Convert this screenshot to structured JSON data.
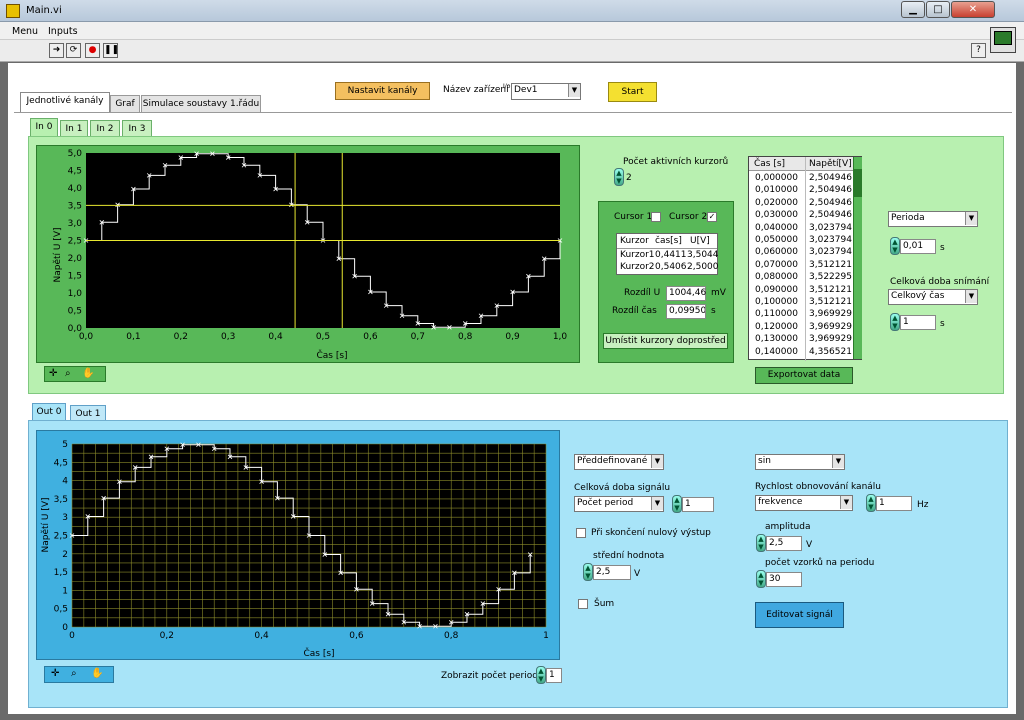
{
  "window": {
    "title": "Main.vi"
  },
  "menu": [
    "Menu",
    "Inputs"
  ],
  "toolbar": {
    "help": "?"
  },
  "top": {
    "set_channels": "Nastavit kanály",
    "device_label": "Název zařízení",
    "device_prefix": "I/o",
    "device_value": "Dev1",
    "start": "Start"
  },
  "main_tabs": [
    "Jednotlivé kanály",
    "Graf",
    "Simulace soustavy 1.řádu"
  ],
  "input_tabs": [
    "In 0",
    "In 1",
    "In 2",
    "In 3"
  ],
  "output_tabs": [
    "Out 0",
    "Out 1"
  ],
  "in_graph": {
    "ylabel": "Napětí U [V]",
    "xlabel": "Čas [s]",
    "yticks": [
      "5,0",
      "4,5",
      "4,0",
      "3,5",
      "3,0",
      "2,5",
      "2,0",
      "1,5",
      "1,0",
      "0,5",
      "0,0"
    ],
    "xticks": [
      "0,0",
      "0,1",
      "0,2",
      "0,3",
      "0,4",
      "0,5",
      "0,6",
      "0,7",
      "0,8",
      "0,9",
      "1,0"
    ]
  },
  "cursors": {
    "count_label": "Počet aktivních kurzorů",
    "count": "2",
    "cursor1_label": "Cursor 1",
    "cursor2_label": "Cursor 2",
    "cursor1_checked": false,
    "cursor2_checked": true,
    "table_headers": [
      "Kurzor",
      "čas[s]",
      "U[V]"
    ],
    "rows": [
      [
        "Kurzor1",
        "0,4411",
        "3,5044"
      ],
      [
        "Kurzor2",
        "0,5406",
        "2,5000"
      ]
    ],
    "diff_u_label": "Rozdíl U",
    "diff_u": "1004,46",
    "diff_u_unit": "mV",
    "diff_t_label": "Rozdíl čas",
    "diff_t": "0,0995025",
    "diff_t_unit": "s",
    "center_button": "Umístit kurzory doprostřed"
  },
  "data_table": {
    "headers": [
      "Čas [s]",
      "Napětí[V]"
    ],
    "rows": [
      [
        "0,000000",
        "2,504946"
      ],
      [
        "0,010000",
        "2,504946"
      ],
      [
        "0,020000",
        "2,504946"
      ],
      [
        "0,030000",
        "2,504946"
      ],
      [
        "0,040000",
        "3,023794"
      ],
      [
        "0,050000",
        "3,023794"
      ],
      [
        "0,060000",
        "3,023794"
      ],
      [
        "0,070000",
        "3,512121"
      ],
      [
        "0,080000",
        "3,522295"
      ],
      [
        "0,090000",
        "3,512121"
      ],
      [
        "0,100000",
        "3,512121"
      ],
      [
        "0,110000",
        "3,969929"
      ],
      [
        "0,120000",
        "3,969929"
      ],
      [
        "0,130000",
        "3,969929"
      ],
      [
        "0,140000",
        "4,356521"
      ]
    ],
    "export_button": "Exportovat data"
  },
  "sampling": {
    "mode": "Perioda",
    "period": "0,01",
    "period_unit": "s",
    "total_label": "Celková doba snímání",
    "total_mode": "Celkový čas",
    "total": "1",
    "total_unit": "s"
  },
  "out_graph": {
    "ylabel": "Napětí U [V]",
    "xlabel": "Čas [s]",
    "yticks": [
      "5",
      "4,5",
      "4",
      "3,5",
      "3",
      "2,5",
      "2",
      "1,5",
      "1",
      "0,5",
      "0"
    ],
    "xticks": [
      "0",
      "0,2",
      "0,4",
      "0,6",
      "0,8",
      "1"
    ]
  },
  "out_controls": {
    "preset": "Předdefinované",
    "duration_label": "Celková doba signálu",
    "duration_mode": "Počet period",
    "duration": "1",
    "zero_output_label": "Při skončení nulový výstup",
    "mean_label": "střední hodnota",
    "mean": "2,5",
    "mean_unit": "V",
    "noise_label": "Šum",
    "waveform": "sin",
    "refresh_label": "Rychlost obnovování kanálu",
    "refresh_mode": "frekvence",
    "refresh": "1",
    "refresh_unit": "Hz",
    "amplitude_label": "amplituda",
    "amplitude": "2,5",
    "amplitude_unit": "V",
    "samples_label": "počet vzorků na periodu",
    "samples": "30",
    "edit_button": "Editovat signál",
    "show_periods_label": "Zobrazit počet period",
    "show_periods": "1"
  },
  "chart_data": [
    {
      "type": "line",
      "title": "",
      "xlabel": "Čas [s]",
      "ylabel": "Napětí U [V]",
      "xlim": [
        0,
        1
      ],
      "ylim": [
        0,
        5
      ],
      "grid": false,
      "cursors": [
        {
          "x": 0.4411,
          "y": 3.5044
        },
        {
          "x": 0.5406,
          "y": 2.5
        }
      ],
      "x": [
        0,
        0.0333,
        0.0667,
        0.1,
        0.1333,
        0.1667,
        0.2,
        0.2333,
        0.2667,
        0.3,
        0.3333,
        0.3667,
        0.4,
        0.4333,
        0.4667,
        0.5,
        0.5333,
        0.5667,
        0.6,
        0.6333,
        0.6667,
        0.7,
        0.7333,
        0.7667,
        0.8,
        0.8333,
        0.8667,
        0.9,
        0.9333,
        0.9667,
        1.0
      ],
      "y": [
        2.5,
        3.02,
        3.52,
        3.97,
        4.36,
        4.65,
        4.87,
        4.98,
        4.98,
        4.87,
        4.65,
        4.36,
        3.97,
        3.52,
        3.02,
        2.5,
        1.98,
        1.48,
        1.03,
        0.64,
        0.35,
        0.13,
        0.02,
        0.02,
        0.13,
        0.35,
        0.64,
        1.03,
        1.48,
        1.98,
        2.5
      ]
    },
    {
      "type": "line",
      "title": "",
      "xlabel": "Čas [s]",
      "ylabel": "Napětí U [V]",
      "xlim": [
        0,
        1
      ],
      "ylim": [
        0,
        5
      ],
      "grid": true,
      "x": [
        0,
        0.0333,
        0.0667,
        0.1,
        0.1333,
        0.1667,
        0.2,
        0.2333,
        0.2667,
        0.3,
        0.3333,
        0.3667,
        0.4,
        0.4333,
        0.4667,
        0.5,
        0.5333,
        0.5667,
        0.6,
        0.6333,
        0.6667,
        0.7,
        0.7333,
        0.7667,
        0.8,
        0.8333,
        0.8667,
        0.9,
        0.9333,
        0.9667
      ],
      "y": [
        2.5,
        3.02,
        3.52,
        3.97,
        4.36,
        4.65,
        4.87,
        4.98,
        4.98,
        4.87,
        4.65,
        4.36,
        3.97,
        3.52,
        3.02,
        2.5,
        1.98,
        1.48,
        1.03,
        0.64,
        0.35,
        0.13,
        0.02,
        0.02,
        0.13,
        0.35,
        0.64,
        1.03,
        1.48,
        1.98
      ]
    }
  ]
}
